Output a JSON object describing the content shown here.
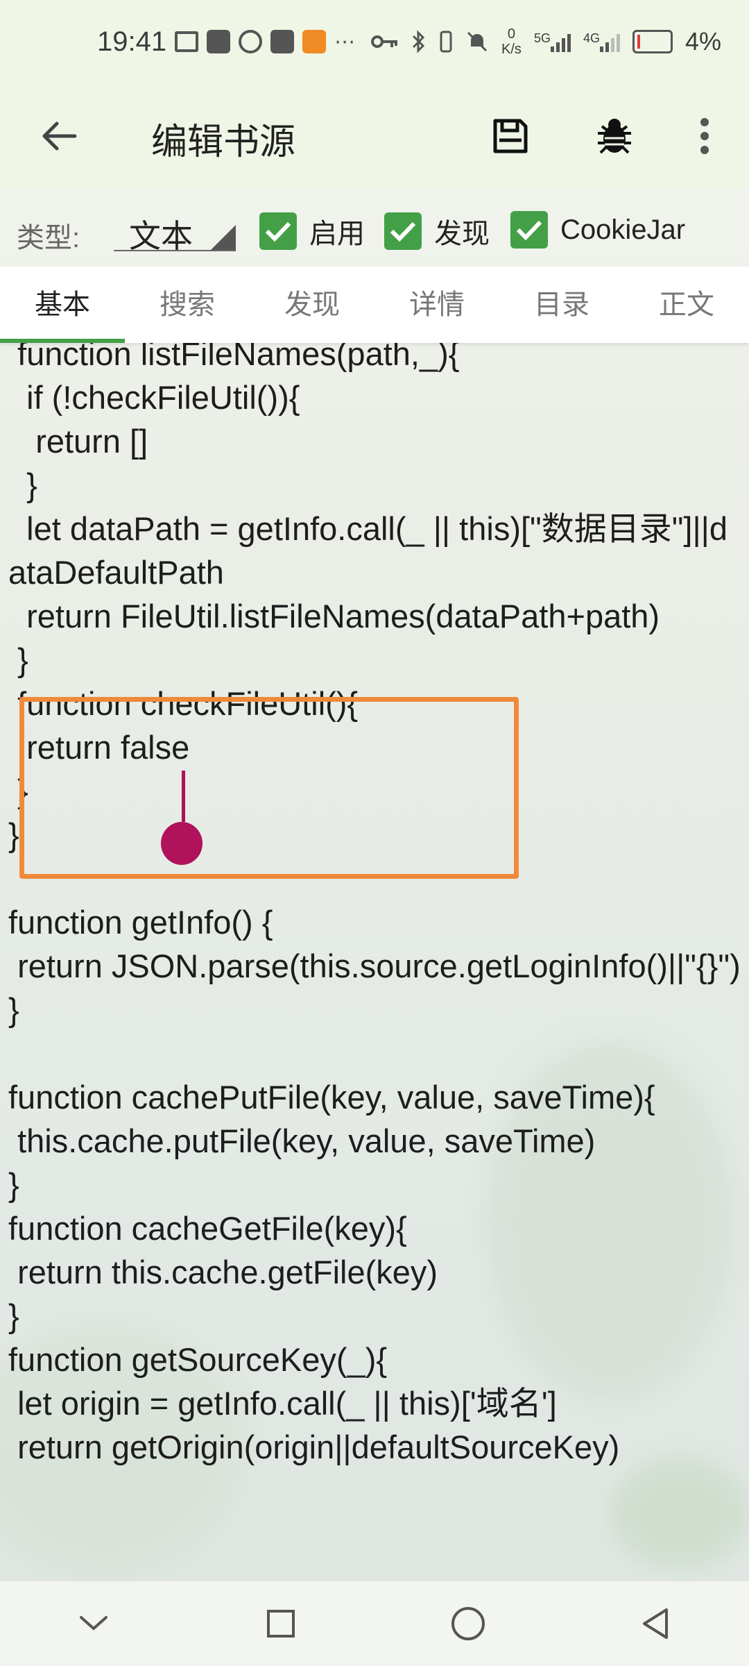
{
  "status_bar": {
    "time": "19:41",
    "net_speed_value": "0",
    "net_speed_unit": "K/s",
    "network_1": "5G",
    "network_2": "4G",
    "battery_percent": "4%"
  },
  "toolbar": {
    "title": "编辑书源"
  },
  "type_row": {
    "label": "类型:",
    "selected_value": "文本",
    "checkboxes": [
      {
        "label": "启用",
        "checked": true
      },
      {
        "label": "发现",
        "checked": true
      },
      {
        "label": "CookieJar",
        "checked": true
      }
    ]
  },
  "tabs": [
    {
      "label": "基本",
      "active": true
    },
    {
      "label": "搜索",
      "active": false
    },
    {
      "label": "发现",
      "active": false
    },
    {
      "label": "详情",
      "active": false
    },
    {
      "label": "目录",
      "active": false
    },
    {
      "label": "正文",
      "active": false
    }
  ],
  "editor": {
    "code": " function listFileNames(path,_){\n  if (!checkFileUtil()){\n   return []\n  }\n  let dataPath = getInfo.call(_ || this)[\"数据目录\"]||dataDefaultPath\n  return FileUtil.listFileNames(dataPath+path)\n }\n function checkFileUtil(){\n  return false\n }\n}\n\nfunction getInfo() {\n return JSON.parse(this.source.getLoginInfo()||\"{}\")\n}\n\nfunction cachePutFile(key, value, saveTime){\n this.cache.putFile(key, value, saveTime)\n}\nfunction cacheGetFile(key){\n return this.cache.getFile(key)\n}\nfunction getSourceKey(_){\n let origin = getInfo.call(_ || this)['域名']\n return getOrigin(origin||defaultSourceKey)"
  },
  "colors": {
    "accent": "#43a047",
    "highlight": "#f08a3a",
    "cursor": "#b0125b",
    "toolbar_bg": "#f0f6e6"
  }
}
